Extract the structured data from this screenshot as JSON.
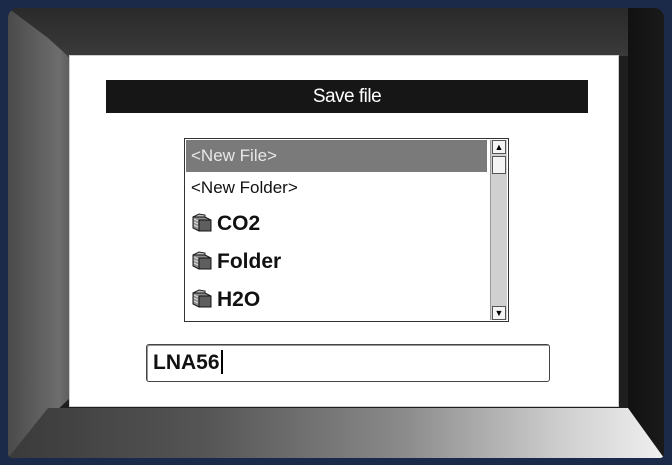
{
  "dialog": {
    "title": "Save file"
  },
  "file_list": {
    "items": [
      {
        "label": "<New File>",
        "type": "new-file",
        "selected": true
      },
      {
        "label": "<New Folder>",
        "type": "new-folder",
        "selected": false
      },
      {
        "label": "CO2",
        "type": "folder",
        "icon": "folder-icon",
        "selected": false
      },
      {
        "label": "Folder",
        "type": "folder",
        "icon": "folder-icon",
        "selected": false
      },
      {
        "label": "H2O",
        "type": "folder",
        "icon": "folder-icon",
        "selected": false
      }
    ]
  },
  "filename_input": {
    "value": "LNA56"
  },
  "colors": {
    "title_bar": "#161616",
    "selection": "#7a7a7a",
    "frame": "#1c2a4a"
  }
}
